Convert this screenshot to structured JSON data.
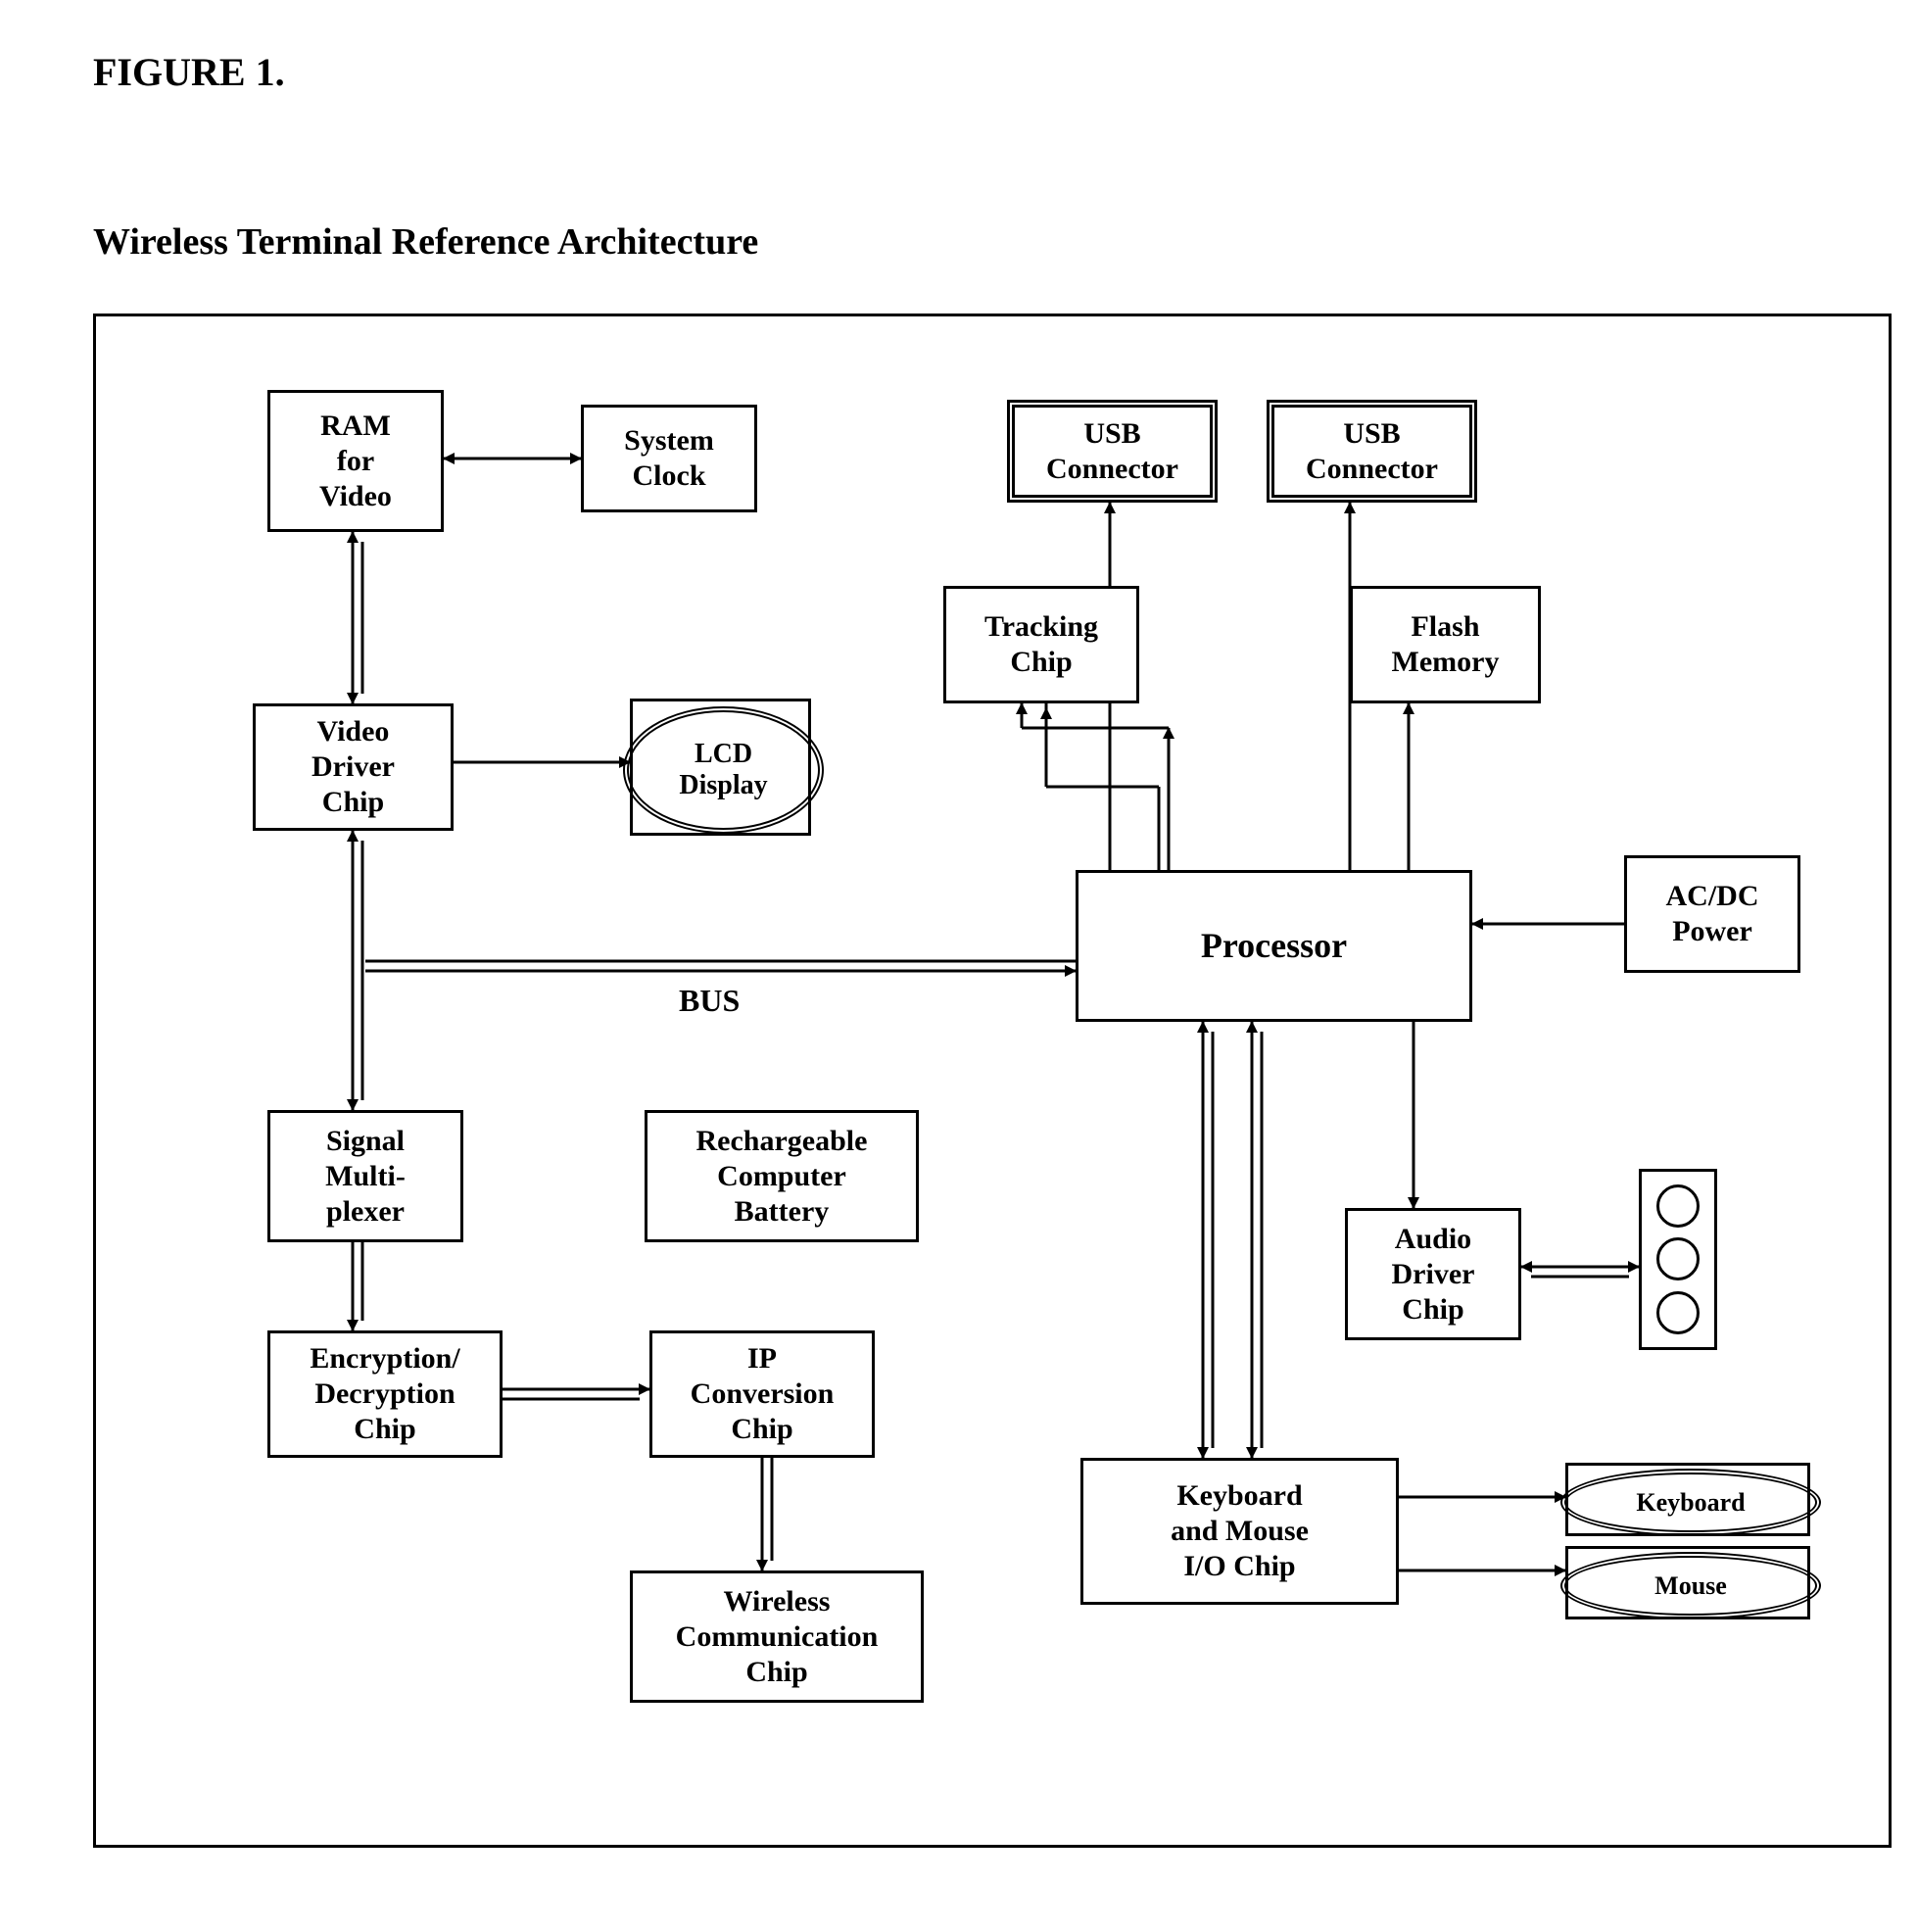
{
  "figure_label": "FIGURE 1.",
  "figure_title": "Wireless Terminal Reference Architecture",
  "bus_label": "BUS",
  "blocks": {
    "ram_video": "RAM\nfor\nVideo",
    "system_clock": "System\nClock",
    "usb1": "USB\nConnector",
    "usb2": "USB\nConnector",
    "tracking_chip": "Tracking\nChip",
    "flash_memory": "Flash\nMemory",
    "video_driver": "Video\nDriver\nChip",
    "lcd_display": "LCD\nDisplay",
    "processor": "Processor",
    "acdc_power": "AC/DC\nPower",
    "signal_mux": "Signal\nMulti-\nplexer",
    "battery": "Rechargeable\nComputer\nBattery",
    "audio_driver": "Audio\nDriver\nChip",
    "encryption": "Encryption/\nDecryption\nChip",
    "ip_conversion": "IP\nConversion\nChip",
    "kb_mouse_io": "Keyboard\nand Mouse\nI/O Chip",
    "keyboard": "Keyboard",
    "mouse": "Mouse",
    "wireless_comm": "Wireless\nCommunication\nChip"
  }
}
